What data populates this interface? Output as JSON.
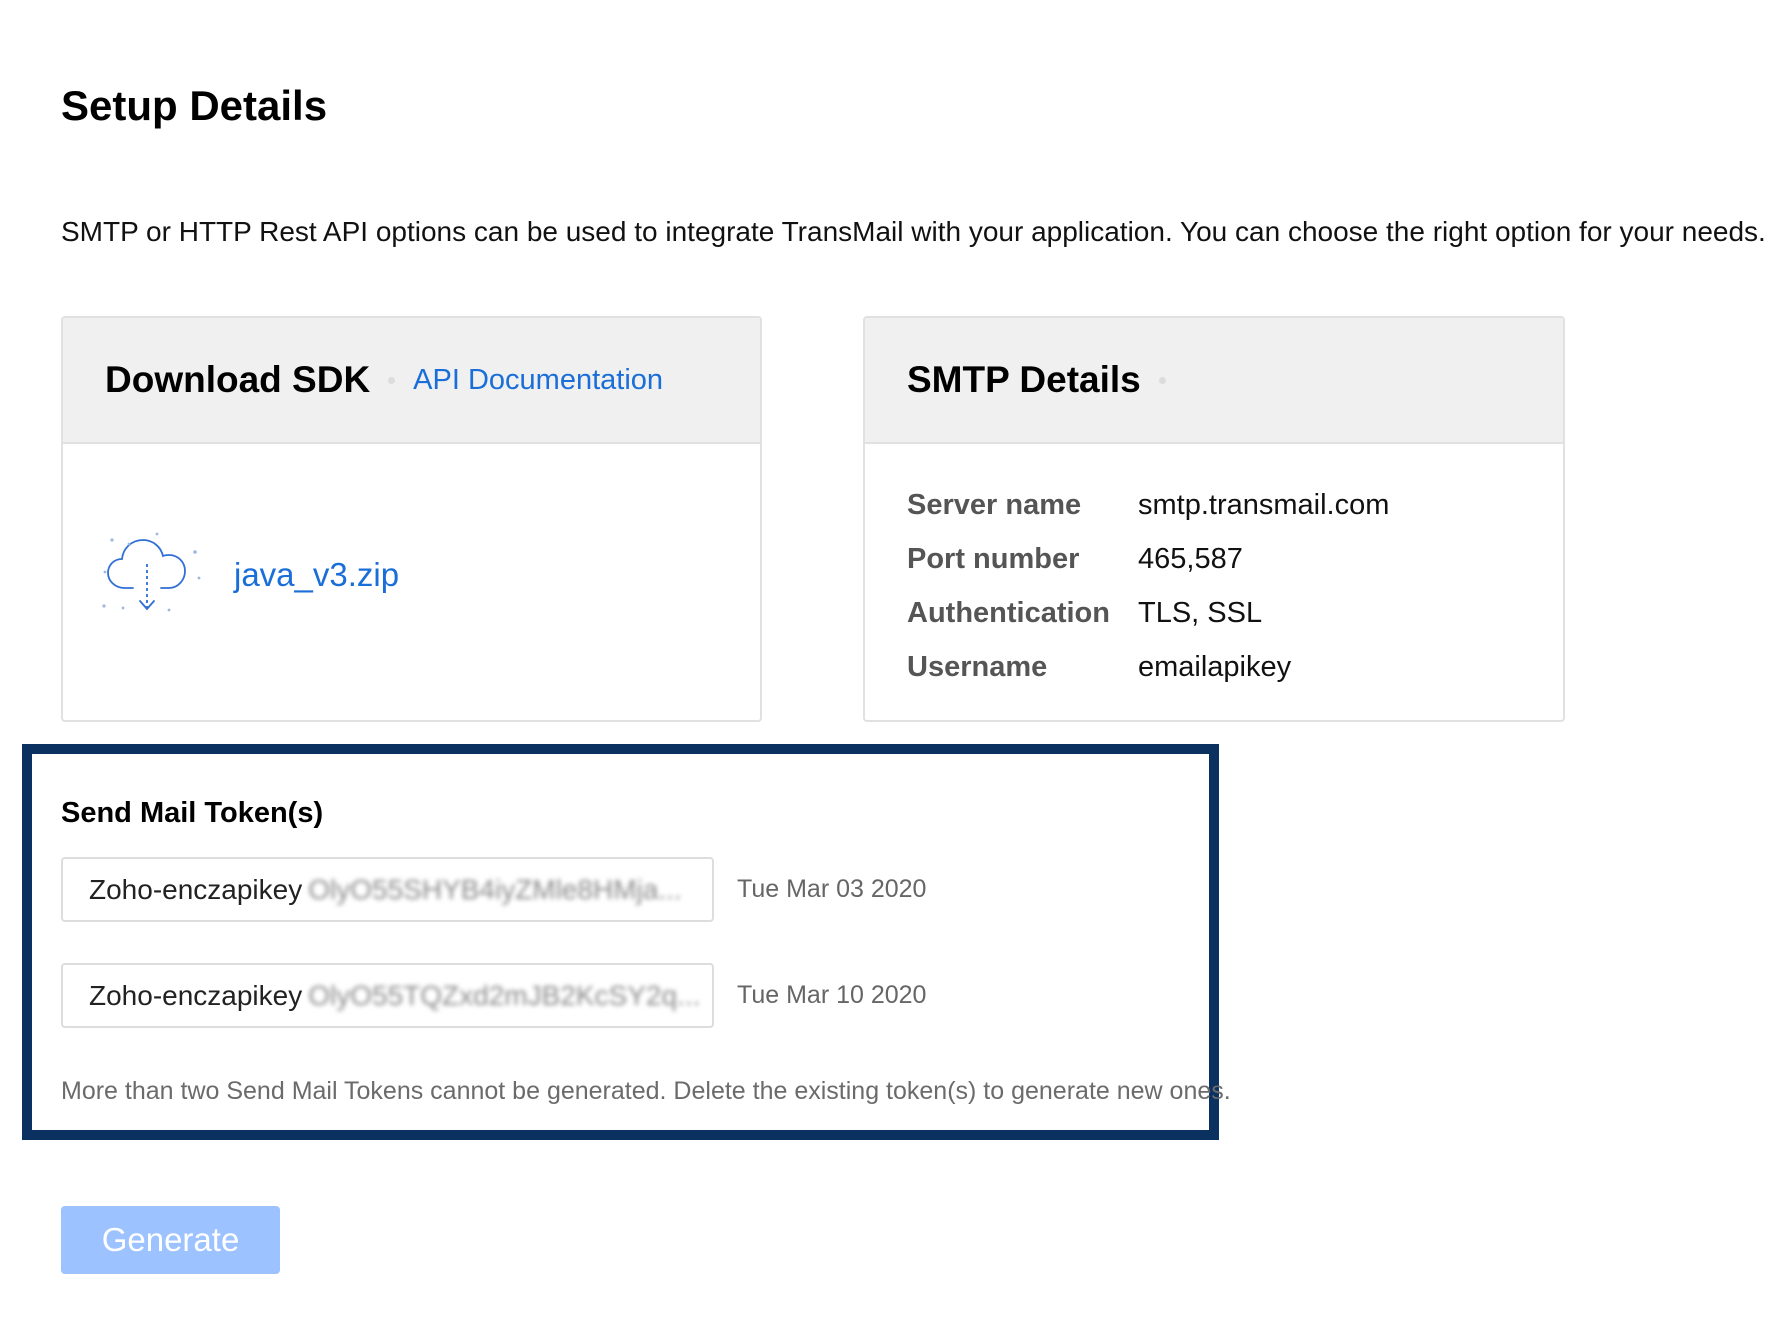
{
  "page": {
    "title": "Setup Details",
    "intro": "SMTP or HTTP Rest API options can be used to integrate TransMail with your application. You can choose the right option for your needs."
  },
  "sdk_card": {
    "title": "Download SDK",
    "api_doc_link": "API Documentation",
    "download_icon": "cloud-download-icon",
    "file_link": "java_v3.zip"
  },
  "smtp_card": {
    "title": "SMTP Details",
    "rows": [
      {
        "label": "Server name",
        "value": "smtp.transmail.com"
      },
      {
        "label": "Port number",
        "value": "465,587"
      },
      {
        "label": "Authentication",
        "value": "TLS, SSL"
      },
      {
        "label": "Username",
        "value": "emailapikey"
      }
    ]
  },
  "tokens": {
    "title": "Send Mail Token(s)",
    "items": [
      {
        "prefix": "Zoho-enczapikey",
        "secret": "OlyO55SHYB4iyZMle8HMja...",
        "date": "Tue Mar 03 2020"
      },
      {
        "prefix": "Zoho-enczapikey",
        "secret": "OlyO55TQZxd2mJB2KcSY2q...",
        "date": "Tue Mar 10 2020"
      }
    ],
    "note": "More than two Send Mail Tokens cannot be generated. Delete the existing token(s) to generate new ones."
  },
  "actions": {
    "generate_label": "Generate",
    "generate_disabled": true
  },
  "colors": {
    "link": "#1a6ed8",
    "highlight_border": "#0b3161",
    "button_disabled": "#9cc2ff",
    "card_header_bg": "#f0f0f0"
  }
}
